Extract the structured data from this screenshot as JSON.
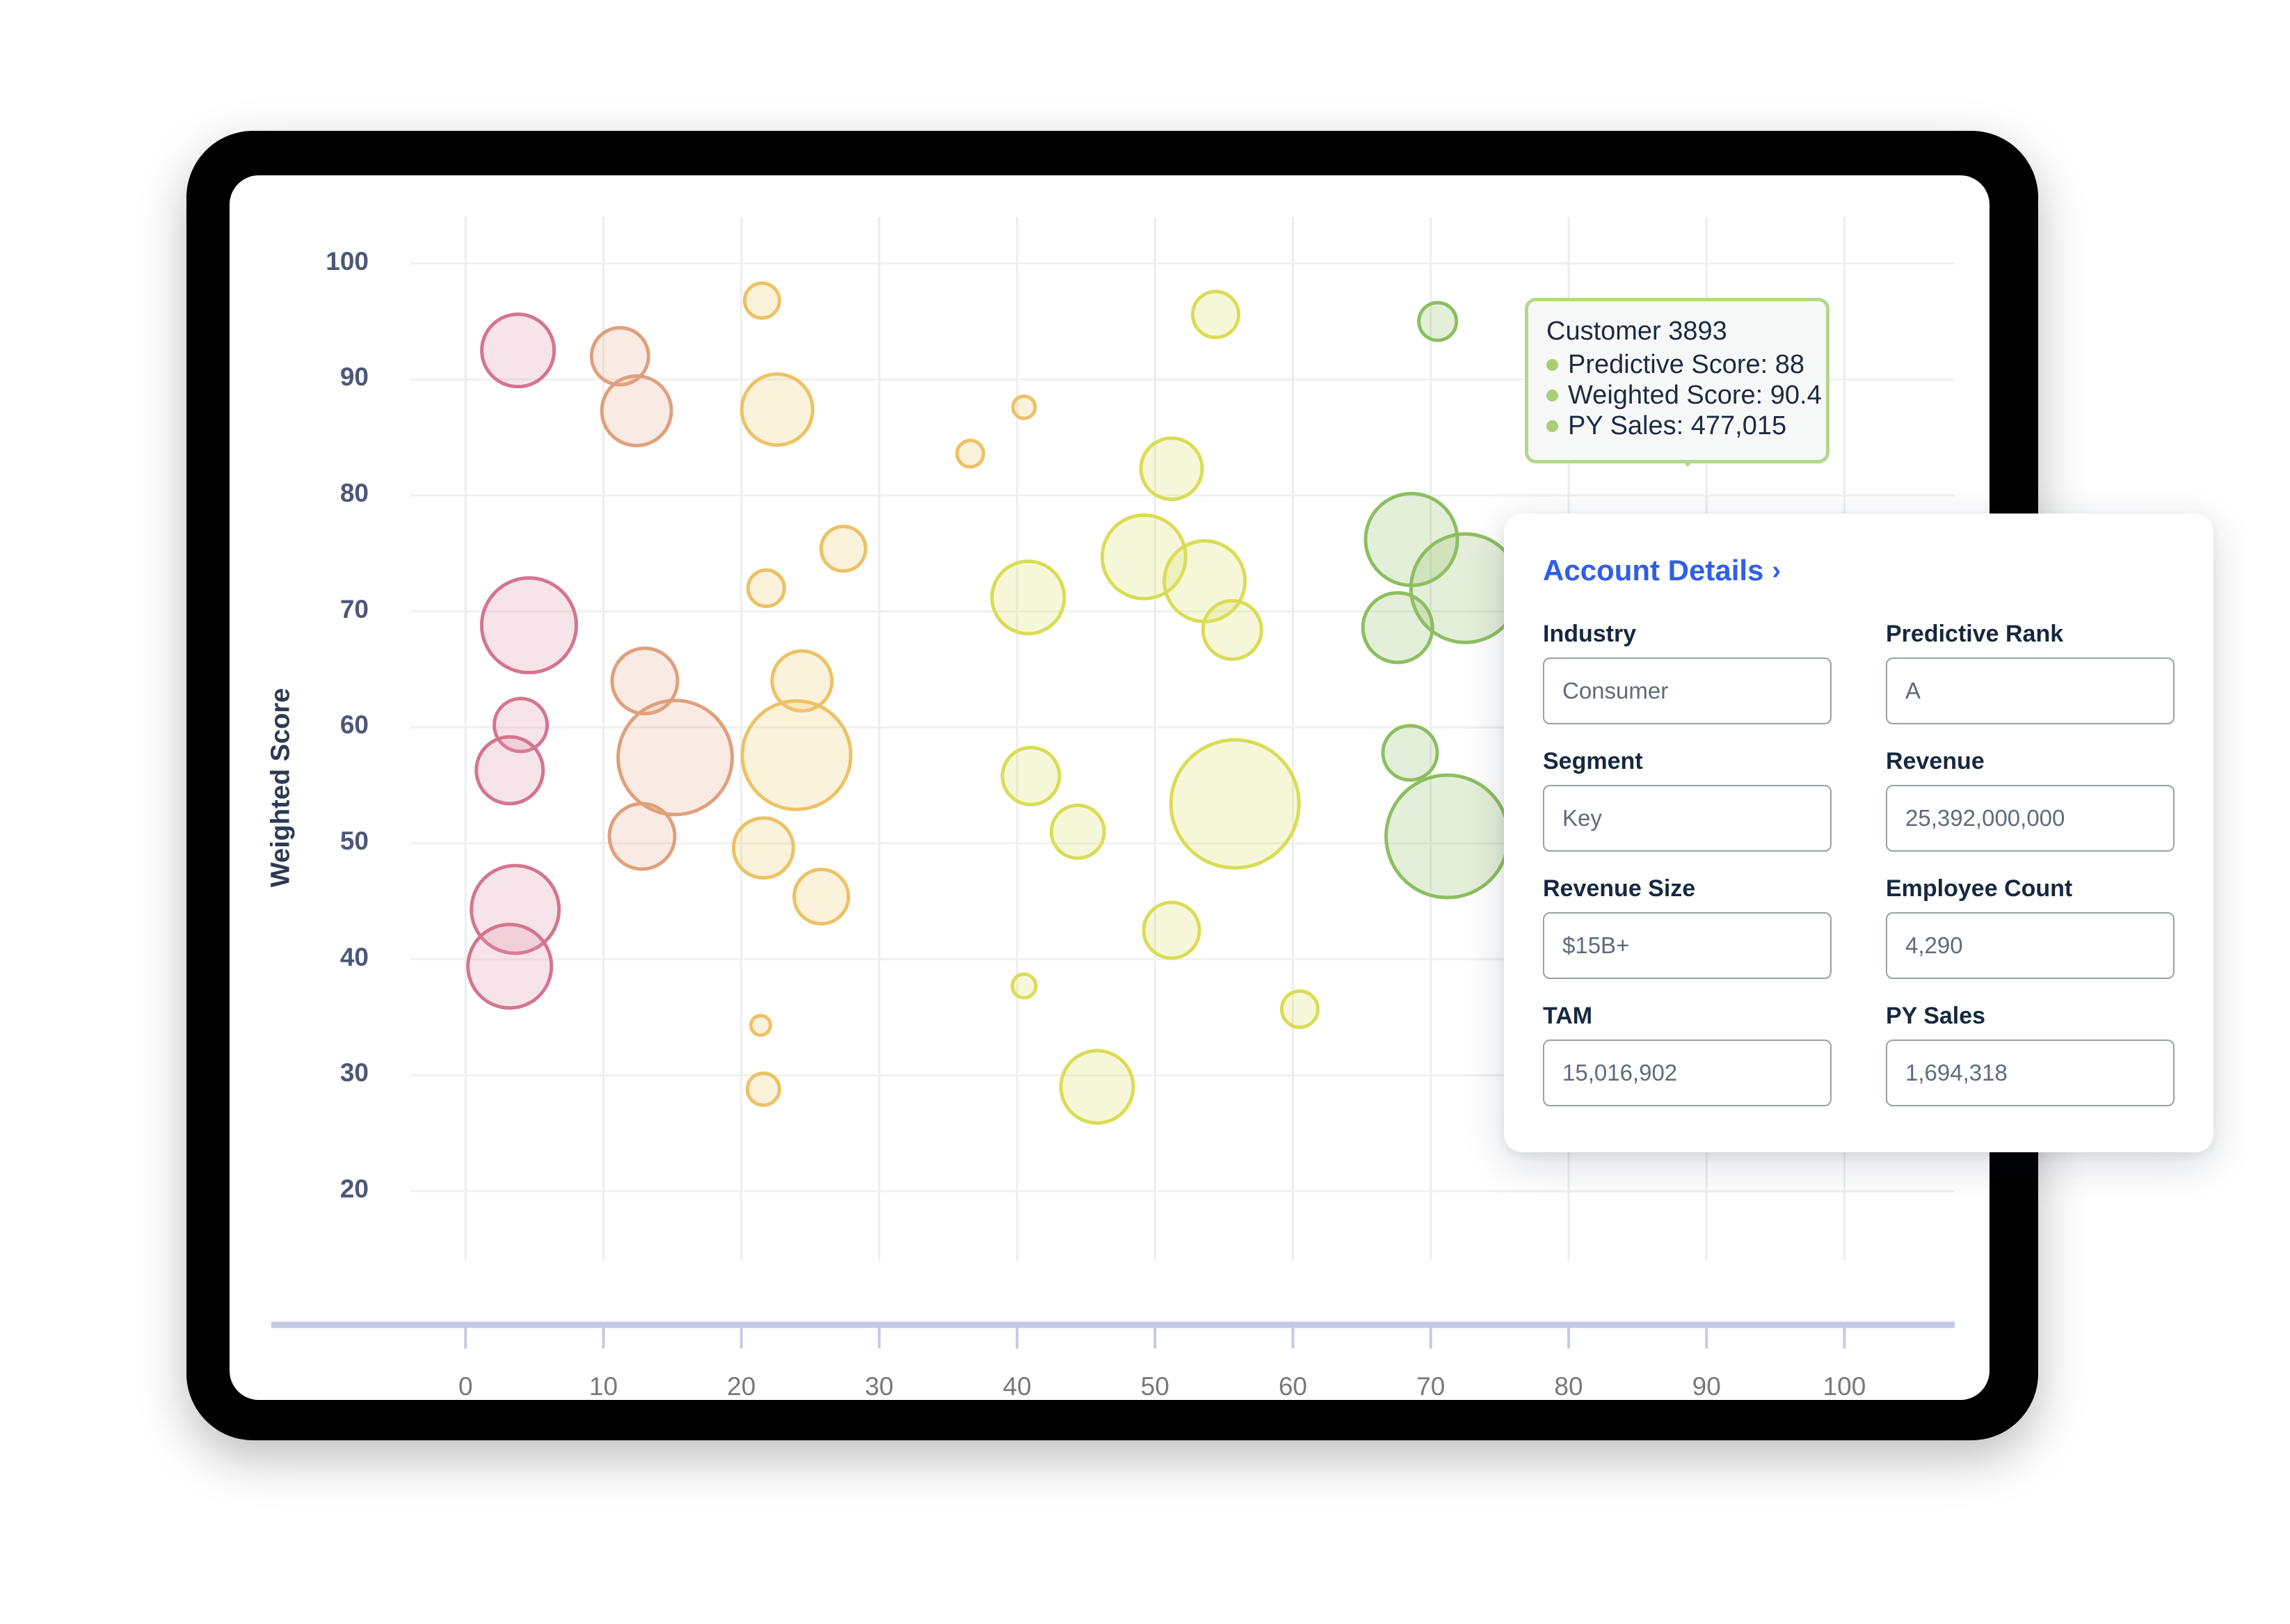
{
  "chart_data": {
    "type": "scatter",
    "title": "",
    "xlabel": "",
    "ylabel": "Weighted Score",
    "xlim": [
      -4,
      108
    ],
    "ylim": [
      14,
      104
    ],
    "grid": true,
    "legend": "none",
    "x_ticks": [
      "0",
      "10",
      "20",
      "30",
      "40",
      "50",
      "60",
      "70",
      "80",
      "90",
      "100"
    ],
    "y_ticks": [
      "20",
      "30",
      "40",
      "50",
      "60",
      "70",
      "80",
      "90",
      "100"
    ],
    "note": "Bubble chart: x = Predictive Score, y = Weighted Score, bubble size = PY Sales, color ramp pink->orange->yellow->green by x",
    "color_ramp": [
      "#d4758f",
      "#e0a07c",
      "#edc264",
      "#d9dd54",
      "#8cbf5f"
    ],
    "points": [
      {
        "x": 3.8,
        "y": 92.5,
        "r": 52,
        "c": "pink"
      },
      {
        "x": 11.2,
        "y": 92.0,
        "r": 41,
        "c": "salmon"
      },
      {
        "x": 12.4,
        "y": 87.3,
        "r": 50,
        "c": "salmon"
      },
      {
        "x": 21.5,
        "y": 96.8,
        "r": 25,
        "c": "yellow1"
      },
      {
        "x": 22.6,
        "y": 87.4,
        "r": 51,
        "c": "yellow1"
      },
      {
        "x": 36.6,
        "y": 83.6,
        "r": 19,
        "c": "yellow1"
      },
      {
        "x": 40.5,
        "y": 87.6,
        "r": 16,
        "c": "yellow1"
      },
      {
        "x": 51.2,
        "y": 82.3,
        "r": 44,
        "c": "yellow2"
      },
      {
        "x": 54.4,
        "y": 95.6,
        "r": 33,
        "c": "yellow2"
      },
      {
        "x": 70.5,
        "y": 95.0,
        "r": 27,
        "c": "green1"
      },
      {
        "x": 86.0,
        "y": 90.4,
        "r": 43,
        "c": "green-selected",
        "selected": true
      },
      {
        "x": 21.8,
        "y": 72.0,
        "r": 26,
        "c": "yellow1"
      },
      {
        "x": 27.4,
        "y": 75.4,
        "r": 32,
        "c": "yellow1"
      },
      {
        "x": 4.6,
        "y": 68.8,
        "r": 68,
        "c": "pink"
      },
      {
        "x": 40.8,
        "y": 71.2,
        "r": 52,
        "c": "yellow2"
      },
      {
        "x": 49.2,
        "y": 74.7,
        "r": 60,
        "c": "yellow2"
      },
      {
        "x": 53.6,
        "y": 72.6,
        "r": 58,
        "c": "yellow2"
      },
      {
        "x": 55.6,
        "y": 68.4,
        "r": 42,
        "c": "yellow2"
      },
      {
        "x": 68.6,
        "y": 76.2,
        "r": 66,
        "c": "green1"
      },
      {
        "x": 72.5,
        "y": 72.0,
        "r": 78,
        "c": "green1"
      },
      {
        "x": 67.6,
        "y": 68.6,
        "r": 50,
        "c": "green1"
      },
      {
        "x": 4.0,
        "y": 60.2,
        "r": 38,
        "c": "pink"
      },
      {
        "x": 13.0,
        "y": 64.0,
        "r": 47,
        "c": "salmon"
      },
      {
        "x": 24.4,
        "y": 64.0,
        "r": 43,
        "c": "yellow1"
      },
      {
        "x": 3.2,
        "y": 56.3,
        "r": 48,
        "c": "pink"
      },
      {
        "x": 15.2,
        "y": 57.4,
        "r": 82,
        "c": "salmon"
      },
      {
        "x": 24.0,
        "y": 57.6,
        "r": 78,
        "c": "yellow1"
      },
      {
        "x": 41.0,
        "y": 55.8,
        "r": 41,
        "c": "yellow2"
      },
      {
        "x": 44.4,
        "y": 51.0,
        "r": 38,
        "c": "yellow2"
      },
      {
        "x": 55.8,
        "y": 53.4,
        "r": 92,
        "c": "yellow2"
      },
      {
        "x": 68.5,
        "y": 57.8,
        "r": 39,
        "c": "green1"
      },
      {
        "x": 71.2,
        "y": 50.6,
        "r": 88,
        "c": "green1"
      },
      {
        "x": 12.8,
        "y": 50.6,
        "r": 47,
        "c": "salmon"
      },
      {
        "x": 21.6,
        "y": 49.6,
        "r": 43,
        "c": "yellow1"
      },
      {
        "x": 25.8,
        "y": 45.4,
        "r": 39,
        "c": "yellow1"
      },
      {
        "x": 3.6,
        "y": 44.3,
        "r": 63,
        "c": "pink"
      },
      {
        "x": 3.2,
        "y": 39.4,
        "r": 60,
        "c": "pink"
      },
      {
        "x": 40.5,
        "y": 37.7,
        "r": 17,
        "c": "yellow2"
      },
      {
        "x": 51.2,
        "y": 42.5,
        "r": 40,
        "c": "yellow2"
      },
      {
        "x": 60.5,
        "y": 35.7,
        "r": 26,
        "c": "yellow2"
      },
      {
        "x": 21.4,
        "y": 34.3,
        "r": 14,
        "c": "yellow1"
      },
      {
        "x": 21.6,
        "y": 28.8,
        "r": 23,
        "c": "yellow1"
      },
      {
        "x": 45.8,
        "y": 29.0,
        "r": 52,
        "c": "yellow2"
      }
    ]
  },
  "tooltip": {
    "title": "Customer 3893",
    "rows": [
      "Predictive Score: 88",
      "Weighted Score: 90.4",
      "PY Sales: 477,015"
    ],
    "accent_color": "#b4d78a",
    "bullet_color": "#a8cf72"
  },
  "account_panel": {
    "link_label": "Account Details",
    "link_chevron": "›",
    "link_color": "#2f5fe8",
    "fields": [
      {
        "label": "Industry",
        "value": "Consumer"
      },
      {
        "label": "Predictive Rank",
        "value": "A"
      },
      {
        "label": "Segment",
        "value": "Key"
      },
      {
        "label": "Revenue",
        "value": "25,392,000,000"
      },
      {
        "label": "Revenue Size",
        "value": "$15B+"
      },
      {
        "label": "Employee Count",
        "value": "4,290"
      },
      {
        "label": "TAM",
        "value": "15,016,902"
      },
      {
        "label": "PY Sales",
        "value": "1,694,318"
      }
    ]
  }
}
